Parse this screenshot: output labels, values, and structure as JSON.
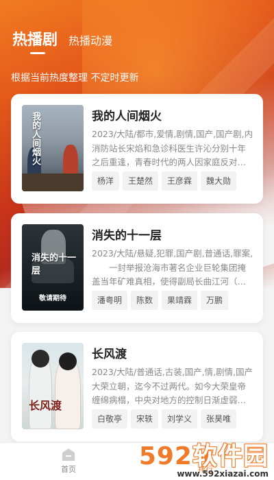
{
  "tabs": [
    {
      "label": "热播剧",
      "active": true
    },
    {
      "label": "热播动漫",
      "active": false
    }
  ],
  "subtitle": "根据当前热度整理 不定时更新",
  "items": [
    {
      "title": "我的人间烟火",
      "meta": "2023/大陆/都市,爱情,剧情,国产,国产剧,内",
      "desc": "消防站长宋焰和急诊科医生许沁分别十年之后重逢，青春时代的两人因家庭反对…",
      "poster_title": "我的人间烟火",
      "cast": [
        "杨洋",
        "王楚然",
        "王彦霖",
        "魏大勋"
      ]
    },
    {
      "title": "消失的十一层",
      "meta": "2023/大陆/悬疑,犯罪,国产剧,普通话,罪案,",
      "desc": "　　一封举报沧海市著名企业巨轮集团掩盖当年矿难真相，使得副局长曲江河（…",
      "poster_title": "消失的十一层",
      "poster_caption": "敬请期待",
      "cast": [
        "潘粤明",
        "陈数",
        "果靖霖",
        "万鹏"
      ]
    },
    {
      "title": "长风渡",
      "meta": "2023/大陆/普通话,古装,国产,情,剧情,国产",
      "desc": "大荣立朝，迄今不过两代。如今大荣皇帝缠绵病榻，中央对地方的控制日渐虚弱…",
      "poster_title": "长风渡",
      "cast": [
        "白敬亭",
        "宋轶",
        "刘学义",
        "张昊唯"
      ]
    }
  ],
  "bottom_nav": [
    {
      "label": "首页",
      "icon": "home-icon",
      "active": false
    },
    {
      "label": "排行",
      "icon": "rank-icon",
      "active": true
    }
  ],
  "watermark": {
    "main_num": "592",
    "main_text": "软件园",
    "url": "www.592xiazai.com"
  },
  "colors": {
    "accent": "#ef7a2a",
    "hero_dark": "#b62a1d"
  }
}
